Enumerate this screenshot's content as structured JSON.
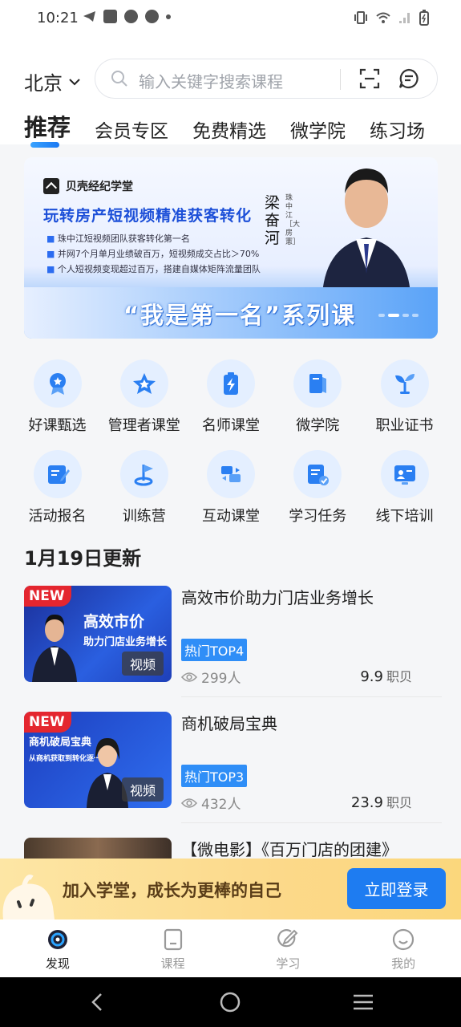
{
  "status_bar": {
    "time": "10:21"
  },
  "header": {
    "city": "北京",
    "search_placeholder": "输入关键字搜索课程",
    "tabs": [
      "推荐",
      "会员专区",
      "免费精选",
      "微学院",
      "练习场"
    ]
  },
  "banner": {
    "brand": "贝壳经纪学堂",
    "headline": "玩转房产短视频精准获客转化",
    "bullets": [
      "珠中江短视频团队获客转化第一名",
      "并网7个月单月业绩破百万，短视频成交占比＞70%",
      "个人短视频变现超过百万，搭建自媒体矩阵流量团队"
    ],
    "speaker_name": "梁奋河",
    "speaker_sub": "珠中江［大房憲］",
    "series": "“我是第一名”系列课"
  },
  "categories": [
    {
      "label": "好课甄选",
      "icon": "medal-icon"
    },
    {
      "label": "管理者课堂",
      "icon": "star-icon"
    },
    {
      "label": "名师课堂",
      "icon": "battery-bolt-icon"
    },
    {
      "label": "微学院",
      "icon": "book-icon"
    },
    {
      "label": "职业证书",
      "icon": "sprout-icon"
    },
    {
      "label": "活动报名",
      "icon": "edit-form-icon"
    },
    {
      "label": "训练营",
      "icon": "flag-icon"
    },
    {
      "label": "互动课堂",
      "icon": "exchange-icon"
    },
    {
      "label": "学习任务",
      "icon": "task-check-icon"
    },
    {
      "label": "线下培训",
      "icon": "presentation-icon"
    }
  ],
  "section_title": "1月19日更新",
  "courses": [
    {
      "new_badge": "NEW",
      "thumb_title": "高效市价",
      "thumb_subtitle": "助力门店业务增长",
      "media": "视频",
      "title": "高效市价助力门店业务增长",
      "tag": "热门TOP4",
      "views": "299人",
      "price": "9.9",
      "unit": "职贝"
    },
    {
      "new_badge": "NEW",
      "thumb_title": "商机破局宝典",
      "thumb_subtitle": "从商机获取到转化逐一解析",
      "media": "视频",
      "title": "商机破局宝典",
      "tag": "热门TOP3",
      "views": "432人",
      "price": "23.9",
      "unit": "职贝"
    },
    {
      "title": "【微电影】《百万门店的团建》"
    }
  ],
  "promo": {
    "text": "加入学堂，成长为更棒的自己",
    "button": "立即登录"
  },
  "bottom_nav": [
    {
      "label": "发现",
      "icon": "discover-icon",
      "active": true
    },
    {
      "label": "课程",
      "icon": "course-icon"
    },
    {
      "label": "学习",
      "icon": "study-icon"
    },
    {
      "label": "我的",
      "icon": "profile-icon"
    }
  ],
  "colors": {
    "accent": "#1e7cf1",
    "tag_blue": "#2f8ef7",
    "new_red": "#e4262f",
    "promo_bg": "#fcd98a",
    "icon_bg": "#e4efff"
  }
}
